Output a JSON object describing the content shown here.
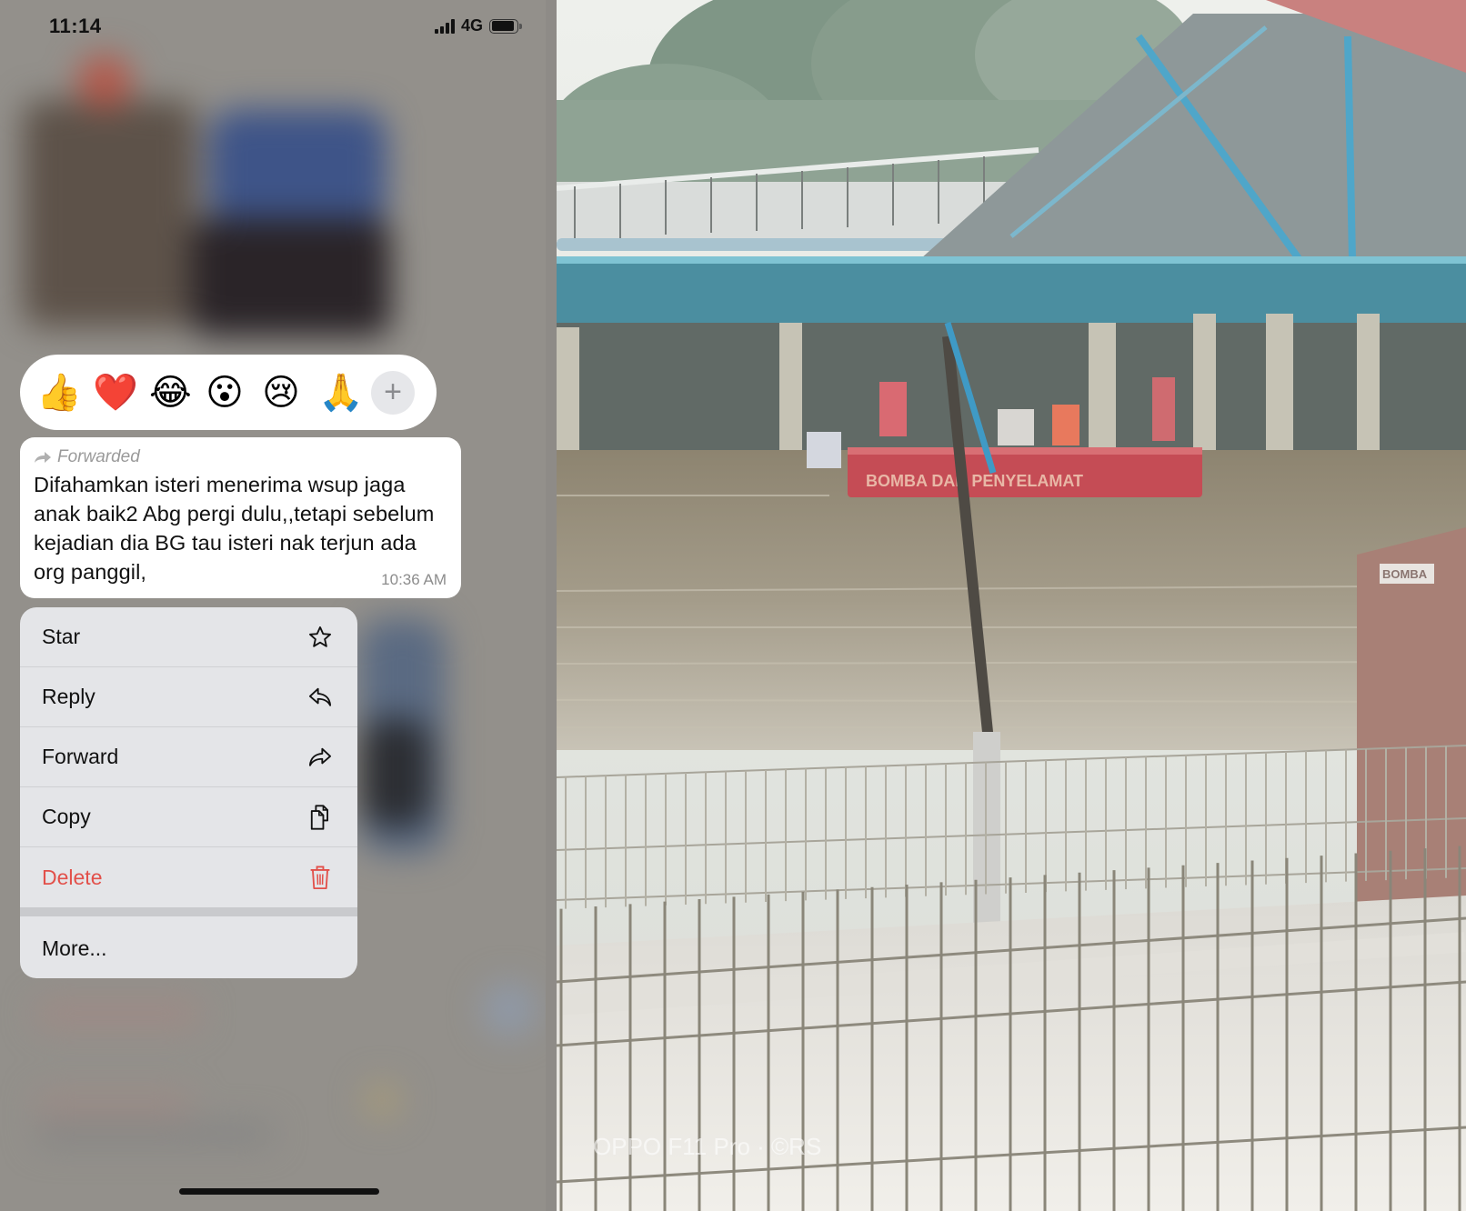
{
  "status_bar": {
    "time": "11:14",
    "network": "4G",
    "signal_icon": "cellular-signal-icon",
    "battery_icon": "battery-icon",
    "battery_level": 0.9
  },
  "reactions": [
    {
      "emoji": "👍",
      "name": "thumbs-up"
    },
    {
      "emoji": "❤️",
      "name": "red-heart"
    },
    {
      "emoji": "😂",
      "name": "tears-of-joy"
    },
    {
      "emoji": "😮",
      "name": "open-mouth"
    },
    {
      "emoji": "😢",
      "name": "crying-face"
    },
    {
      "emoji": "🙏",
      "name": "folded-hands"
    }
  ],
  "reaction_more_label": "+",
  "message": {
    "forwarded_label": "Forwarded",
    "text": "Difahamkan isteri menerima wsup jaga anak baik2 Abg pergi dulu,,tetapi sebelum kejadian dia BG tau isteri nak terjun ada org panggil,",
    "time": "10:36 AM"
  },
  "context_menu": {
    "items": [
      {
        "label": "Star",
        "icon": "star-icon"
      },
      {
        "label": "Reply",
        "icon": "reply-icon"
      },
      {
        "label": "Forward",
        "icon": "forward-icon"
      },
      {
        "label": "Copy",
        "icon": "copy-icon"
      },
      {
        "label": "Delete",
        "icon": "trash-icon",
        "destructive": true
      }
    ],
    "more_label": "More..."
  },
  "photo": {
    "boat_text": "BOMBA DAN PENYELAMAT",
    "uniform_text": "BOMBA",
    "watermark": "OPPO F11 Pro · ©RS"
  },
  "colors": {
    "destructive": "#e2504a",
    "menu_bg": "#e4e5e8",
    "overlay_bg": "#93908b"
  }
}
